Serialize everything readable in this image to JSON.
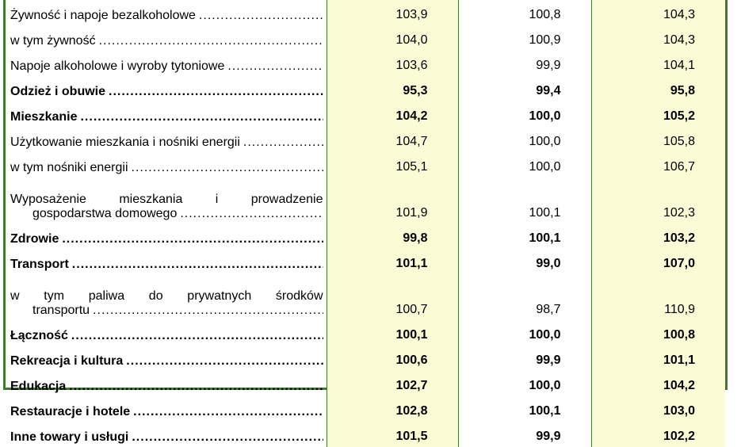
{
  "rows": [
    {
      "label": [
        "Żywność i napoje bezalkoholowe"
      ],
      "indent": false,
      "bold": false,
      "v1": "103,9",
      "v2": "100,8",
      "v3": "104,3"
    },
    {
      "label": [
        "w tym żywność"
      ],
      "indent": true,
      "bold": false,
      "v1": "104,0",
      "v2": "100,9",
      "v3": "104,3"
    },
    {
      "label": [
        "Napoje alkoholowe i wyroby tytoniowe"
      ],
      "indent": false,
      "bold": false,
      "v1": "103,6",
      "v2": "99,9",
      "v3": "104,1"
    },
    {
      "label": [
        "Odzież i obuwie"
      ],
      "indent": false,
      "bold": true,
      "v1": "95,3",
      "v2": "99,4",
      "v3": "95,8"
    },
    {
      "label": [
        "Mieszkanie"
      ],
      "indent": false,
      "bold": true,
      "v1": "104,2",
      "v2": "100,0",
      "v3": "105,2"
    },
    {
      "label": [
        "Użytkowanie mieszkania i nośniki energii"
      ],
      "indent": false,
      "bold": false,
      "v1": "104,7",
      "v2": "100,0",
      "v3": "105,8"
    },
    {
      "label": [
        "w tym nośniki energii"
      ],
      "indent": true,
      "bold": false,
      "v1": "105,1",
      "v2": "100,0",
      "v3": "106,7"
    },
    {
      "label": [
        "Wyposażenie mieszkania i prowadzenie",
        "gospodarstwa domowego"
      ],
      "indent": false,
      "bold": false,
      "v1": "101,9",
      "v2": "100,1",
      "v3": "102,3"
    },
    {
      "label": [
        "Zdrowie"
      ],
      "indent": false,
      "bold": true,
      "v1": "99,8",
      "v2": "100,1",
      "v3": "103,2"
    },
    {
      "label": [
        "Transport"
      ],
      "indent": false,
      "bold": true,
      "v1": "101,1",
      "v2": "99,0",
      "v3": "107,0"
    },
    {
      "label": [
        "w tym paliwa do prywatnych środków",
        "transportu"
      ],
      "indent": true,
      "bold": false,
      "v1": "100,7",
      "v2": "98,7",
      "v3": "110,9"
    },
    {
      "label": [
        "Łączność"
      ],
      "indent": false,
      "bold": true,
      "v1": "100,1",
      "v2": "100,0",
      "v3": "100,8"
    },
    {
      "label": [
        "Rekreacja i kultura"
      ],
      "indent": false,
      "bold": true,
      "v1": "100,6",
      "v2": "99,9",
      "v3": "101,1"
    },
    {
      "label": [
        "Edukacja"
      ],
      "indent": false,
      "bold": true,
      "v1": "102,7",
      "v2": "100,0",
      "v3": "104,2"
    },
    {
      "label": [
        "Restauracje i hotele"
      ],
      "indent": false,
      "bold": true,
      "v1": "102,8",
      "v2": "100,1",
      "v3": "103,0"
    },
    {
      "label": [
        "Inne towary i usługi"
      ],
      "indent": false,
      "bold": true,
      "v1": "101,5",
      "v2": "99,9",
      "v3": "102,2"
    }
  ],
  "colors": {
    "border": "#3f7a2e",
    "highlight_column": "#fbfbd6"
  }
}
